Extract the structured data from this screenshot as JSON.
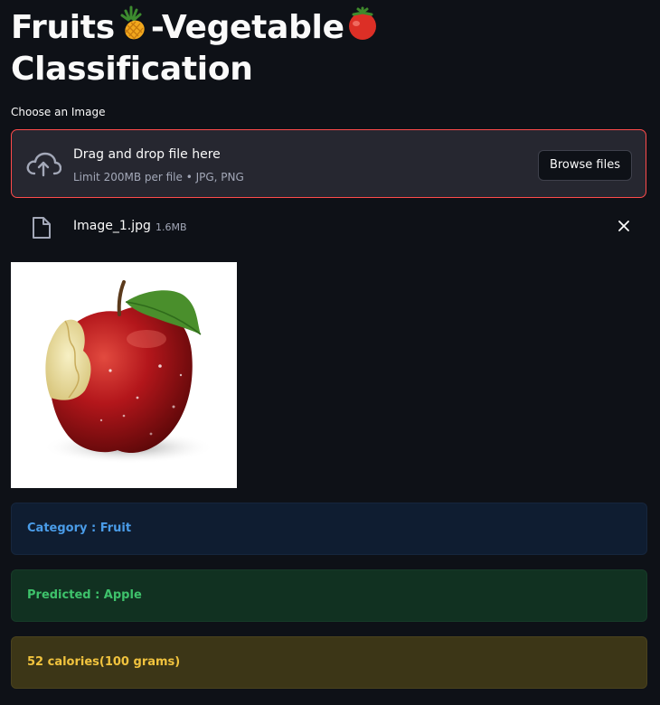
{
  "title": {
    "part1": "Fruits",
    "part2": "-Vegetable",
    "part3": "Classification",
    "emoji1": "pineapple-emoji",
    "emoji2": "tomato-emoji"
  },
  "uploader": {
    "label": "Choose an Image",
    "drag_text": "Drag and drop file here",
    "limit_text": "Limit 200MB per file • JPG, PNG",
    "browse_label": "Browse files",
    "icon": "cloud-upload-icon",
    "accent": "#ff4b4b"
  },
  "file": {
    "name": "Image_1.jpg",
    "size": "1.6MB",
    "icon": "file-icon",
    "remove_icon": "close-icon"
  },
  "preview": {
    "subject": "apple"
  },
  "results": {
    "category": "Category : Fruit",
    "predicted": "Predicted : Apple",
    "calories": "52 calories(100 grams)",
    "colors": {
      "info": "#4a9ce8",
      "success": "#3ec26b",
      "warning": "#f1c33e"
    }
  }
}
